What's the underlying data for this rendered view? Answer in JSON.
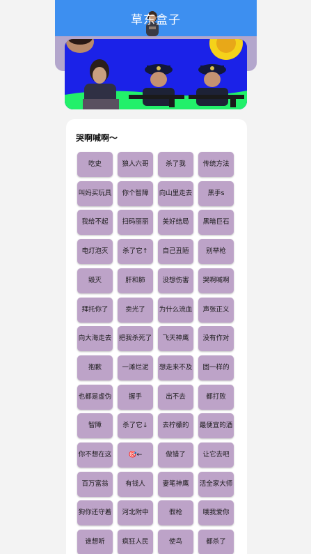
{
  "app": {
    "title": "草东盒子"
  },
  "section": {
    "title": "哭啊喊啊～"
  },
  "buttons": [
    "吃史",
    "狼人六哥",
    "杀了我",
    "传统方法",
    "叫妈买玩具",
    "你个智障",
    "向山里走去",
    "黑手s",
    "我给不起",
    "扫码丽丽",
    "美好结局",
    "黑暗巨石",
    "电灯泡灭",
    "杀了它↑",
    "自己丑陋",
    "别举枪",
    "毁灭",
    "肝和肺",
    "没想伤害",
    "哭啊喊啊",
    "拜托你了",
    "卖光了",
    "为什么流血",
    "声张正义",
    "向大海走去",
    "把我杀死了",
    "飞天神鹰",
    "没有作对",
    "抱歉",
    "一滩烂泥",
    "想走来不及",
    "固一样的",
    "也都是虚伪",
    "握手",
    "出不去",
    "都打败",
    "智障",
    "杀了它↓",
    "去柠檬的",
    "最便宜的酒",
    "你不想在这",
    "🎯←",
    "做错了",
    "让它去吧",
    "百万富翁",
    "有钱人",
    "妻笔神鹰",
    "活全家大师",
    "狗你还守着",
    "河北附中",
    "假枪",
    "哦我爱你",
    "谁想听",
    "疯狂人民",
    "使鸟",
    "都杀了"
  ]
}
